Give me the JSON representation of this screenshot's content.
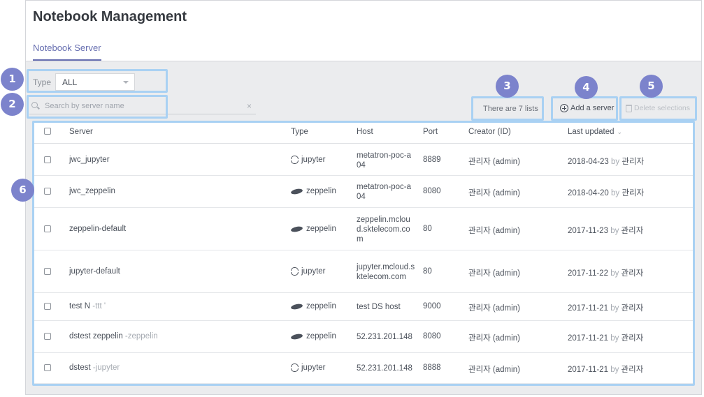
{
  "header": {
    "title": "Notebook Management",
    "tabs": [
      {
        "label": "Notebook Server"
      }
    ]
  },
  "filters": {
    "type_label": "Type",
    "type_selected": "ALL",
    "search_placeholder": "Search by server name",
    "clear_icon": "×"
  },
  "toolbar": {
    "count_text": "There are 7 lists",
    "add_label": "Add a server",
    "delete_label": "Delete selections"
  },
  "callouts": [
    "1",
    "2",
    "3",
    "4",
    "5",
    "6"
  ],
  "table": {
    "columns": {
      "server": "Server",
      "type": "Type",
      "host": "Host",
      "port": "Port",
      "creator": "Creator (ID)",
      "updated": "Last updated"
    },
    "sort_icon": "⌄",
    "rows": [
      {
        "name": "jwc_jupyter",
        "desc": "",
        "type": "jupyter",
        "icon": "jupyter-icon",
        "host": "metatron-poc-a04",
        "port": "8889",
        "creator": "관리자 (admin)",
        "date": "2018-04-23",
        "by": "by",
        "user": "관리자"
      },
      {
        "name": "jwc_zeppelin",
        "desc": "",
        "type": "zeppelin",
        "icon": "zeppelin-icon",
        "host": "metatron-poc-a04",
        "port": "8080",
        "creator": "관리자 (admin)",
        "date": "2018-04-20",
        "by": "by",
        "user": "관리자"
      },
      {
        "name": "zeppelin-default",
        "desc": "",
        "type": "zeppelin",
        "icon": "zeppelin-icon",
        "host": "zeppelin.mcloud.sktelecom.com",
        "port": "80",
        "creator": "관리자 (admin)",
        "date": "2017-11-23",
        "by": "by",
        "user": "관리자"
      },
      {
        "name": "jupyter-default",
        "desc": "",
        "type": "jupyter",
        "icon": "jupyter-icon",
        "host": "jupyter.mcloud.sktelecom.com",
        "port": "80",
        "creator": "관리자 (admin)",
        "date": "2017-11-22",
        "by": "by",
        "user": "관리자"
      },
      {
        "name": "test N",
        "desc": "-ttt '",
        "type": "zeppelin",
        "icon": "zeppelin-icon",
        "host": "test DS host",
        "port": "9000",
        "creator": "관리자 (admin)",
        "date": "2017-11-21",
        "by": "by",
        "user": "관리자"
      },
      {
        "name": "dstest zeppelin",
        "desc": "-zeppelin",
        "type": "zeppelin",
        "icon": "zeppelin-icon",
        "host": "52.231.201.148",
        "port": "8080",
        "creator": "관리자 (admin)",
        "date": "2017-11-21",
        "by": "by",
        "user": "관리자"
      },
      {
        "name": "dstest",
        "desc": "-jupyter",
        "type": "jupyter",
        "icon": "jupyter-icon",
        "host": "52.231.201.148",
        "port": "8888",
        "creator": "관리자 (admin)",
        "date": "2017-11-21",
        "by": "by",
        "user": "관리자"
      }
    ]
  }
}
